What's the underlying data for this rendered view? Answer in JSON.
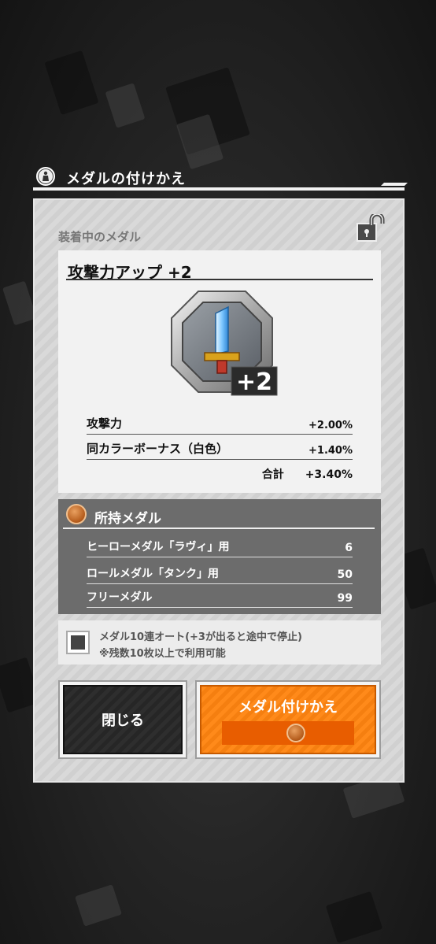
{
  "dialog": {
    "title": "メダルの付けかえ"
  },
  "equipped": {
    "section_label": "装着中のメダル",
    "medal_name": "攻撃力アップ +2",
    "medal_level_badge": "+2",
    "stats": [
      {
        "label": "攻撃力",
        "value": "+2.00%"
      },
      {
        "label": "同カラーボーナス（白色）",
        "value": "+1.40%"
      }
    ],
    "total_label": "合計",
    "total_value": "+3.40%"
  },
  "owned": {
    "title": "所持メダル",
    "items": [
      {
        "label": "ヒーローメダル「ラヴィ」用",
        "count": "6"
      },
      {
        "label": "ロールメダル「タンク」用",
        "count": "50"
      },
      {
        "label": "フリーメダル",
        "count": "99"
      }
    ]
  },
  "auto": {
    "line1": "メダル10連オート(+3が出ると途中で停止)",
    "line2": "※残数10枚以上で利用可能"
  },
  "buttons": {
    "close_label": "閉じる",
    "change_label": "メダル付けかえ"
  },
  "icons": {
    "header": "medal-person-icon",
    "lock": "lock-icon",
    "medal": "sword-medal-icon",
    "owned": "bronze-medal-icon"
  },
  "colors": {
    "accent": "#f57f10",
    "panel": "#d6d6d6",
    "owned_bg": "#6c6c6c"
  }
}
